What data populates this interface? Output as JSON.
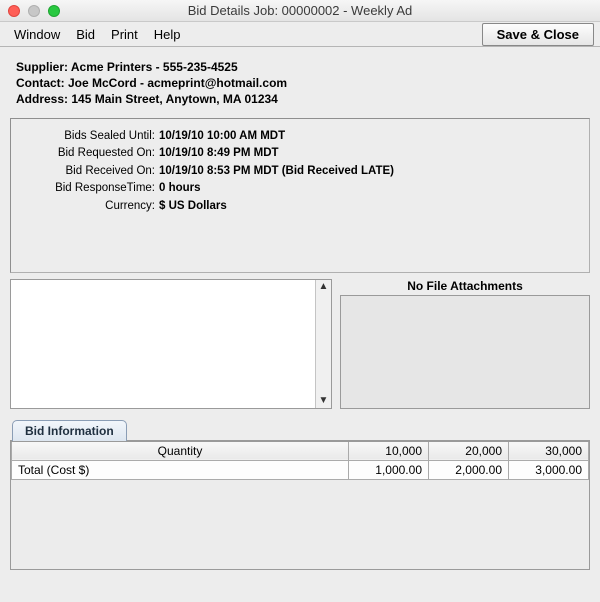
{
  "window": {
    "title": "Bid Details Job: 00000002 - Weekly Ad"
  },
  "menu": {
    "window": "Window",
    "bid": "Bid",
    "print": "Print",
    "help": "Help",
    "save_close": "Save & Close"
  },
  "supplier": {
    "line1": "Supplier: Acme Printers - 555-235-4525",
    "line2": "Contact: Joe McCord - acmeprint@hotmail.com",
    "line3": "Address: 145 Main Street, Anytown, MA  01234"
  },
  "bid_meta": {
    "sealed_label": "Bids Sealed Until:",
    "sealed_value": "10/19/10 10:00 AM MDT",
    "requested_label": "Bid Requested On:",
    "requested_value": "10/19/10 8:49 PM MDT",
    "received_label": "Bid Received On:",
    "received_value": "10/19/10 8:53 PM MDT (Bid Received LATE)",
    "response_label": "Bid ResponseTime:",
    "response_value": "0 hours",
    "currency_label": "Currency:",
    "currency_value": "$ US Dollars"
  },
  "attachments": {
    "header": "No File Attachments"
  },
  "tab": {
    "label": "Bid Information"
  },
  "grid": {
    "quantity_header": "Quantity",
    "cols": {
      "c1": "10,000",
      "c2": "20,000",
      "c3": "30,000"
    },
    "row1": {
      "label": "Total (Cost $)",
      "c1": "1,000.00",
      "c2": "2,000.00",
      "c3": "3,000.00"
    }
  }
}
